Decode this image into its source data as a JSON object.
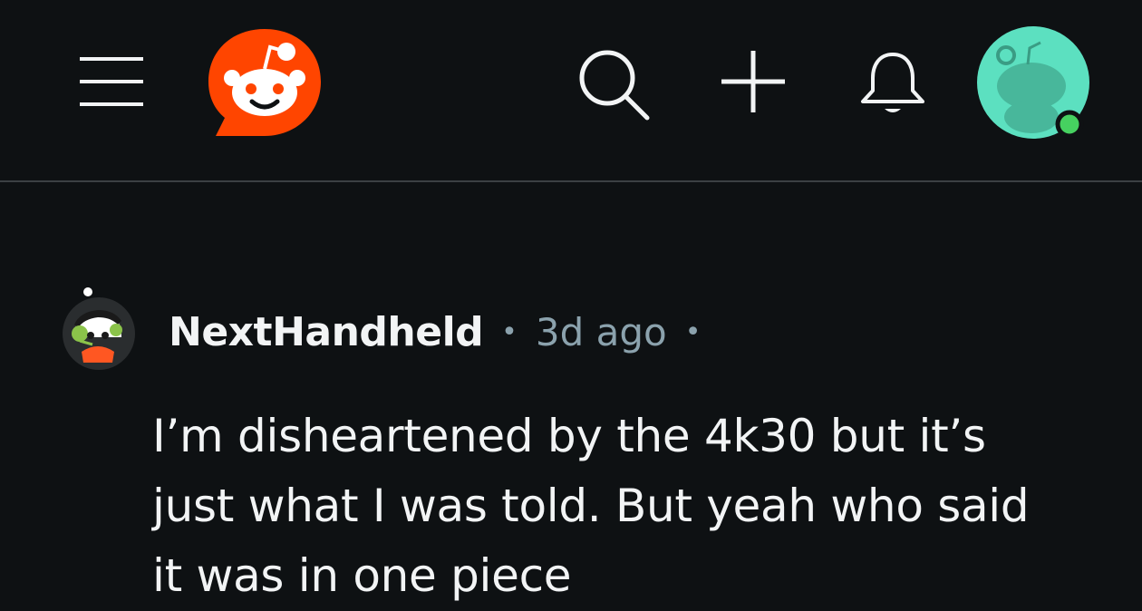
{
  "header": {
    "menu_icon": "hamburger-menu-icon",
    "logo_icon": "reddit-snoo-logo",
    "search_icon": "search-icon",
    "create_icon": "plus-icon",
    "notifications_icon": "bell-icon",
    "avatar_icon": "user-avatar-snoo",
    "online_indicator_color": "#46d160"
  },
  "comment": {
    "username": "NextHandheld",
    "separator": "•",
    "timestamp": "3d ago",
    "trailing_separator": "•",
    "lines": [
      "I’m disheartened by the 4k30 but it’s",
      "just what I was told. But yeah who said",
      "it was in one piece"
    ]
  },
  "colors": {
    "background": "#0e1113",
    "brand": "#ff4500",
    "avatar_bg": "#5ce0c0",
    "meta_text": "#8ba2ad"
  }
}
